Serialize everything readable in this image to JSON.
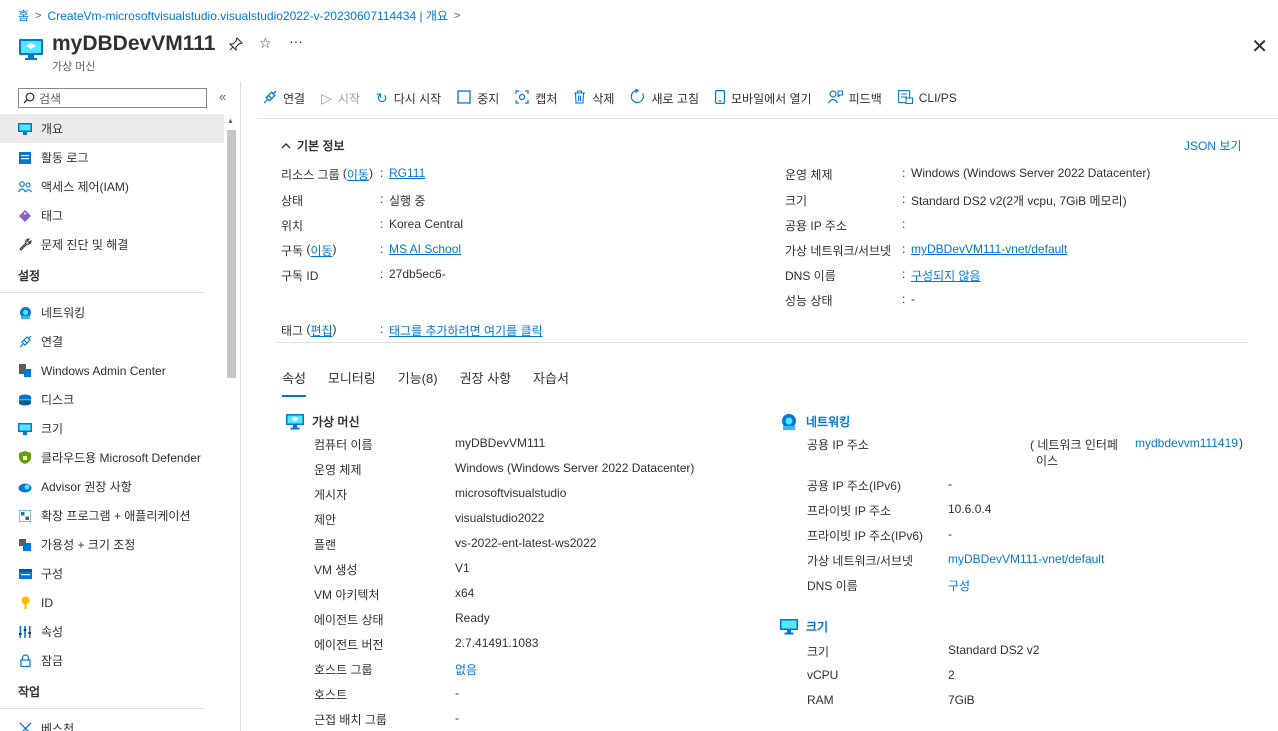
{
  "breadcrumb": {
    "home": "홈",
    "deployment": "CreateVm-microsoftvisualstudio.visualstudio2022-v-20230607114434 | 개요"
  },
  "header": {
    "title": "myDBDevVM111",
    "subtitle": "가상 머신"
  },
  "search": {
    "placeholder": "검색"
  },
  "sidebar": {
    "items": [
      {
        "label": "개요",
        "icon": "monitor-icon",
        "active": true
      },
      {
        "label": "활동 로그",
        "icon": "activity-log-icon"
      },
      {
        "label": "액세스 제어(IAM)",
        "icon": "people-icon"
      },
      {
        "label": "태그",
        "icon": "tag-icon"
      },
      {
        "label": "문제 진단 및 해결",
        "icon": "wrench-icon"
      }
    ],
    "settings_title": "설정",
    "settings": [
      {
        "label": "네트워킹",
        "icon": "network-icon"
      },
      {
        "label": "연결",
        "icon": "connect-icon"
      },
      {
        "label": "Windows Admin Center",
        "icon": "admin-center-icon"
      },
      {
        "label": "디스크",
        "icon": "disk-icon"
      },
      {
        "label": "크기",
        "icon": "size-icon"
      },
      {
        "label": "클라우드용 Microsoft Defender",
        "icon": "shield-icon"
      },
      {
        "label": "Advisor 권장 사항",
        "icon": "advisor-icon"
      },
      {
        "label": "확장 프로그램 + 애플리케이션",
        "icon": "extension-icon"
      },
      {
        "label": "가용성 + 크기 조정",
        "icon": "availability-icon"
      },
      {
        "label": "구성",
        "icon": "config-icon"
      },
      {
        "label": "ID",
        "icon": "identity-icon"
      },
      {
        "label": "속성",
        "icon": "properties-icon"
      },
      {
        "label": "잠금",
        "icon": "lock-icon"
      }
    ],
    "ops_title": "작업",
    "ops": [
      {
        "label": "베스천",
        "icon": "bastion-icon"
      }
    ]
  },
  "toolbar": {
    "connect": "연결",
    "start": "시작",
    "restart": "다시 시작",
    "stop": "중지",
    "capture": "캡처",
    "delete": "삭제",
    "refresh": "새로 고침",
    "mobile": "모바일에서 열기",
    "feedback": "피드백",
    "cli": "CLI/PS"
  },
  "essentials": {
    "title": "기본 정보",
    "json_view": "JSON 보기",
    "resource_group_label": "리소스 그룹",
    "move_link": "이동",
    "resource_group": "RG111",
    "status_label": "상태",
    "status": "실행 중",
    "location_label": "위치",
    "location": "Korea Central",
    "subscription_label": "구독",
    "subscription": "MS AI School",
    "subscription_id_label": "구독 ID",
    "subscription_id": "27db5ec6-",
    "os_label": "운영 체제",
    "os": "Windows (Windows Server 2022 Datacenter)",
    "size_label": "크기",
    "size": "Standard DS2 v2(2개 vcpu, 7GiB 메모리)",
    "public_ip_label": "공용 IP 주소",
    "public_ip": "",
    "vnet_label": "가상 네트워크/서브넷",
    "vnet": "myDBDevVM111-vnet/default",
    "dns_label": "DNS 이름",
    "dns": "구성되지 않음",
    "health_label": "성능 상태",
    "health": "-",
    "tags_label": "태그",
    "edit_link": "편집",
    "tags_value": "태그를 추가하려면 여기를 클릭"
  },
  "tabs": [
    "속성",
    "모니터링",
    "기능(8)",
    "권장 사항",
    "자습서"
  ],
  "vm": {
    "title": "가상 머신",
    "rows": [
      {
        "label": "컴퓨터 이름",
        "value": "myDBDevVM111"
      },
      {
        "label": "운영 체제",
        "value": "Windows (Windows Server 2022 Datacenter)"
      },
      {
        "label": "게시자",
        "value": "microsoftvisualstudio"
      },
      {
        "label": "제안",
        "value": "visualstudio2022"
      },
      {
        "label": "플랜",
        "value": "vs-2022-ent-latest-ws2022"
      },
      {
        "label": "VM 생성",
        "value": "V1"
      },
      {
        "label": "VM 아키텍처",
        "value": "x64"
      },
      {
        "label": "에이전트 상태",
        "value": "Ready"
      },
      {
        "label": "에이전트 버전",
        "value": "2.7.41491.1083"
      },
      {
        "label": "호스트 그룹",
        "value": "없음"
      },
      {
        "label": "호스트",
        "value": "-"
      },
      {
        "label": "근접 배치 그룹",
        "value": "-"
      }
    ]
  },
  "networking": {
    "title": "네트워킹",
    "public_ip_label": "공용 IP 주소",
    "nic_prefix": "( 네트워크 인터페",
    "nic_prefix2": "이스",
    "nic_link": "mydbdevvm111419",
    "nic_suffix": ")",
    "ipv6_label": "공용 IP 주소(IPv6)",
    "ipv6": "-",
    "private_ip_label": "프라이빗 IP 주소",
    "private_ip": "10.6.0.4",
    "private_ipv6_label": "프라이빗 IP 주소(IPv6)",
    "private_ipv6": "-",
    "vnet_label": "가상 네트워크/서브넷",
    "vnet": "myDBDevVM111-vnet/default",
    "dns_label": "DNS 이름",
    "dns": "구성"
  },
  "size": {
    "title": "크기",
    "size_label": "크기",
    "size": "Standard DS2 v2",
    "vcpu_label": "vCPU",
    "vcpu": "2",
    "ram_label": "RAM",
    "ram": "7GiB"
  },
  "colors": {
    "accent": "#0078d4",
    "text": "#323130",
    "muted": "#605e5c",
    "border": "#e1dfdd",
    "active_bg": "#edebe9"
  }
}
